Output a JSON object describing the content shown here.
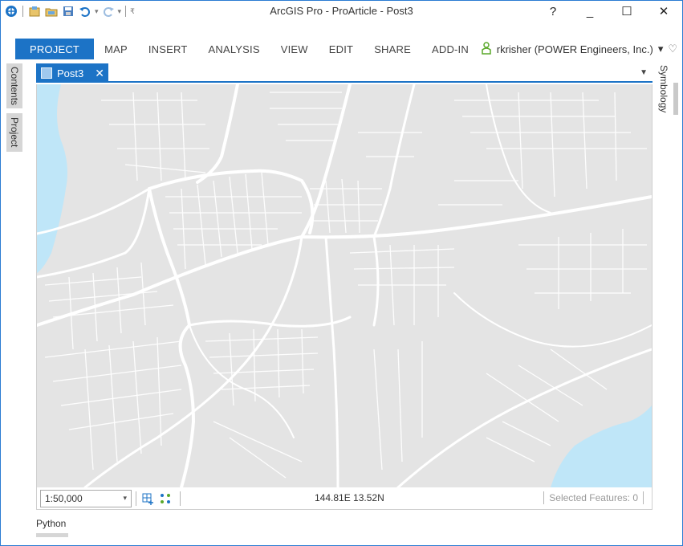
{
  "window": {
    "title": "ArcGIS Pro - ProArticle - Post3",
    "controls": {
      "help": "?",
      "minimize": "_",
      "maximize": "☐",
      "close": "✕"
    }
  },
  "qat": {
    "icons": [
      "arcgis-logo-icon",
      "new-project-icon",
      "open-project-icon",
      "save-project-icon",
      "undo-icon",
      "redo-icon",
      "customize-icon"
    ]
  },
  "ribbon": {
    "tabs": [
      {
        "label": "PROJECT",
        "active": true
      },
      {
        "label": "MAP"
      },
      {
        "label": "INSERT"
      },
      {
        "label": "ANALYSIS"
      },
      {
        "label": "VIEW"
      },
      {
        "label": "EDIT"
      },
      {
        "label": "SHARE"
      },
      {
        "label": "ADD-IN"
      }
    ],
    "user": "rkrisher (POWER Engineers, Inc.)",
    "user_dropdown": "▾",
    "collapse": "♡"
  },
  "left_dock": {
    "contents": "Contents",
    "project": "Project"
  },
  "right_dock": {
    "symbology": "Symbology"
  },
  "map_view": {
    "tab_label": "Post3",
    "tab_close": "✕",
    "overflow": "▼"
  },
  "status": {
    "scale": "1:50,000",
    "coords": "144.81E 13.52N",
    "selected": "Selected Features: 0"
  },
  "bottom_dock": {
    "python": "Python"
  },
  "colors": {
    "accent": "#1c73c6",
    "water": "#bfe6f8",
    "land": "#e4e4e4",
    "roads": "#ffffff"
  }
}
